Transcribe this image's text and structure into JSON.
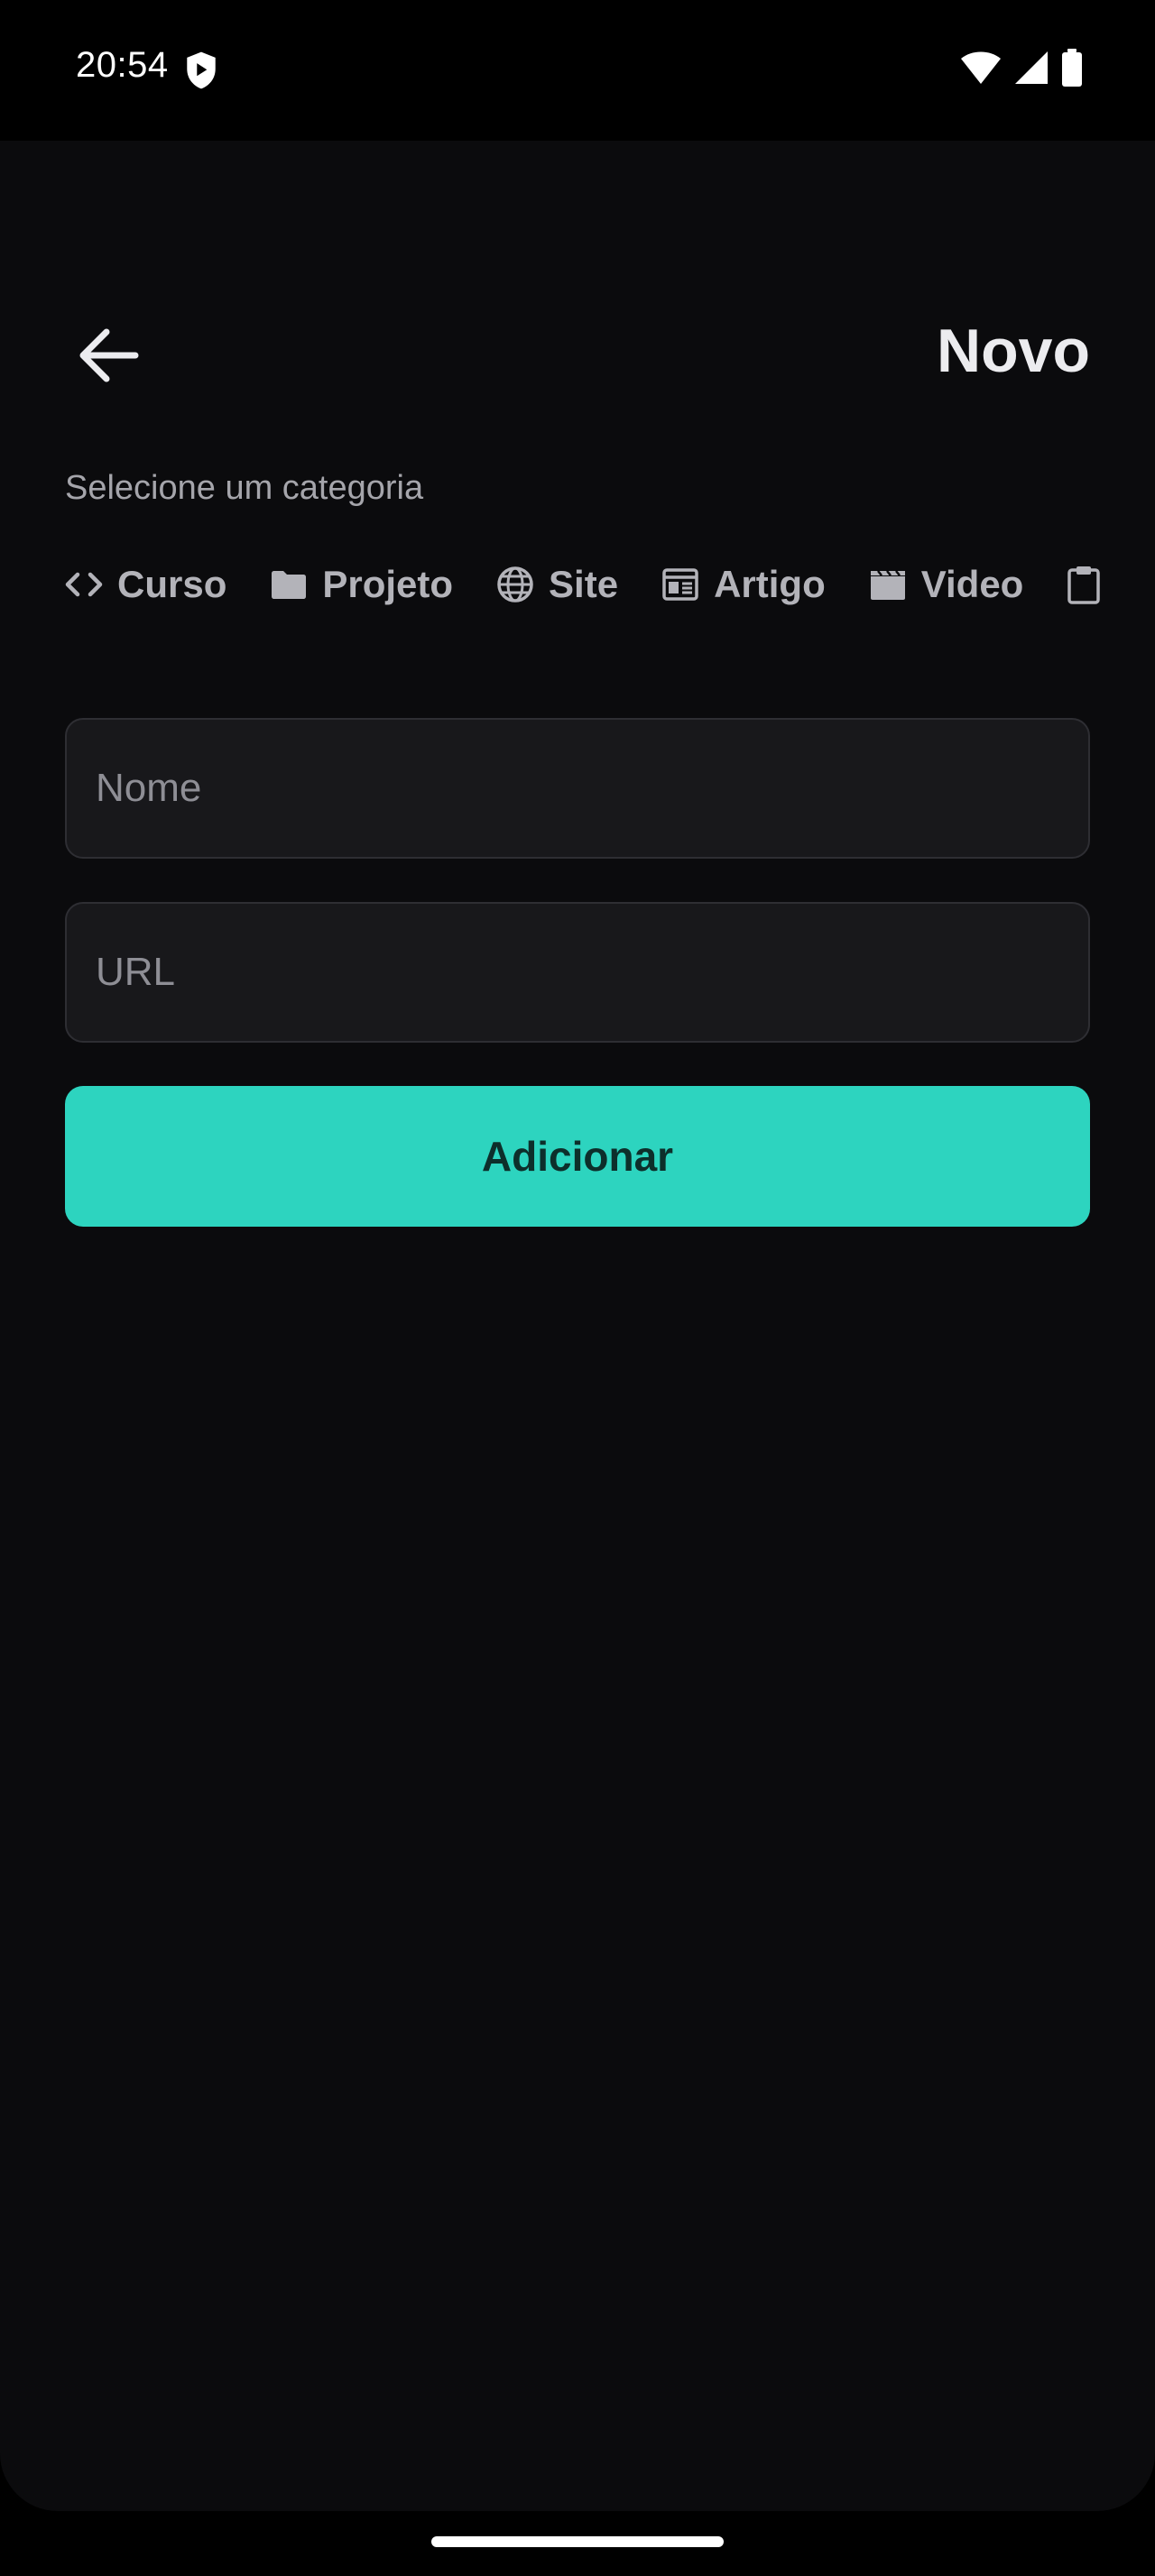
{
  "status_bar": {
    "time": "20:54",
    "icons": [
      "shield-icon",
      "wifi-icon",
      "signal-icon",
      "battery-icon"
    ]
  },
  "header": {
    "title": "Novo",
    "back_icon": "arrow-left-icon"
  },
  "categories": {
    "label": "Selecione um categoria",
    "items": [
      {
        "label": "Curso",
        "icon": "code-icon"
      },
      {
        "label": "Projeto",
        "icon": "folder-icon"
      },
      {
        "label": "Site",
        "icon": "globe-icon"
      },
      {
        "label": "Artigo",
        "icon": "article-icon"
      },
      {
        "label": "Video",
        "icon": "clapper-icon"
      },
      {
        "label": "",
        "icon": "clipboard-icon"
      }
    ]
  },
  "form": {
    "name_placeholder": "Nome",
    "url_placeholder": "URL",
    "submit_label": "Adicionar"
  },
  "colors": {
    "background": "#0b0b0d",
    "accent": "#2dd4bf",
    "field_background": "#18181b",
    "muted_text": "#a5a5ab"
  }
}
